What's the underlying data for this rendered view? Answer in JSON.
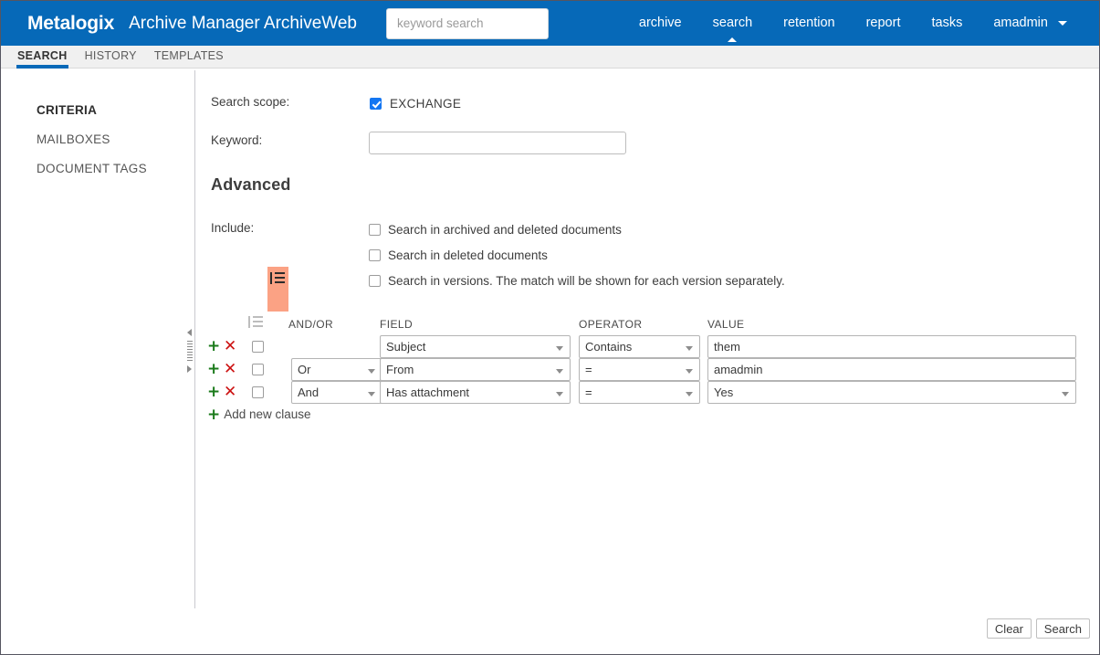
{
  "header": {
    "brand": "Metalogix",
    "app_title": "Archive Manager ArchiveWeb",
    "search_placeholder": "keyword search",
    "search_value": "",
    "nav": [
      {
        "label": "archive",
        "active": false
      },
      {
        "label": "search",
        "active": true
      },
      {
        "label": "retention",
        "active": false
      },
      {
        "label": "report",
        "active": false
      },
      {
        "label": "tasks",
        "active": false
      },
      {
        "label": "amadmin",
        "active": false,
        "has_caret": true
      }
    ],
    "brand_blue": "#0669b8"
  },
  "tabs": [
    {
      "label": "SEARCH",
      "active": true
    },
    {
      "label": "HISTORY",
      "active": false
    },
    {
      "label": "TEMPLATES",
      "active": false
    }
  ],
  "sidebar": {
    "items": [
      {
        "label": "CRITERIA",
        "active": true
      },
      {
        "label": "MAILBOXES",
        "active": false
      },
      {
        "label": "DOCUMENT TAGS",
        "active": false
      }
    ]
  },
  "criteria": {
    "scope_label": "Search scope:",
    "scope_option": "EXCHANGE",
    "scope_checked": true,
    "keyword_label": "Keyword:",
    "keyword_value": "",
    "advanced_heading": "Advanced",
    "include_label": "Include:",
    "include_options": [
      {
        "label": "Search in archived and deleted documents",
        "checked": false
      },
      {
        "label": "Search in deleted documents",
        "checked": false
      },
      {
        "label": "Search in versions. The match will be shown for each version separately.",
        "checked": false
      }
    ]
  },
  "clause_table": {
    "columns": {
      "group_icon": "bracket-list-icon",
      "andor": "AND/OR",
      "field": "FIELD",
      "operator": "OPERATOR",
      "value": "VALUE"
    },
    "group_highlight_color": "#fba284",
    "group_icon_name": "bracket-list-icon",
    "rows": [
      {
        "selected": false,
        "andor": "",
        "andor_visible": false,
        "field": "Subject",
        "operator": "Contains",
        "value": "them",
        "value_is_dropdown": false
      },
      {
        "selected": false,
        "andor": "Or",
        "andor_visible": true,
        "field": "From",
        "operator": "=",
        "value": "amadmin",
        "value_is_dropdown": false
      },
      {
        "selected": false,
        "andor": "And",
        "andor_visible": true,
        "field": "Has attachment",
        "operator": "=",
        "value": "Yes",
        "value_is_dropdown": true
      }
    ],
    "add_icon": "+",
    "delete_icon": "✕",
    "add_clause_label": "Add new clause"
  },
  "footer": {
    "clear_label": "Clear",
    "search_label": "Search"
  }
}
